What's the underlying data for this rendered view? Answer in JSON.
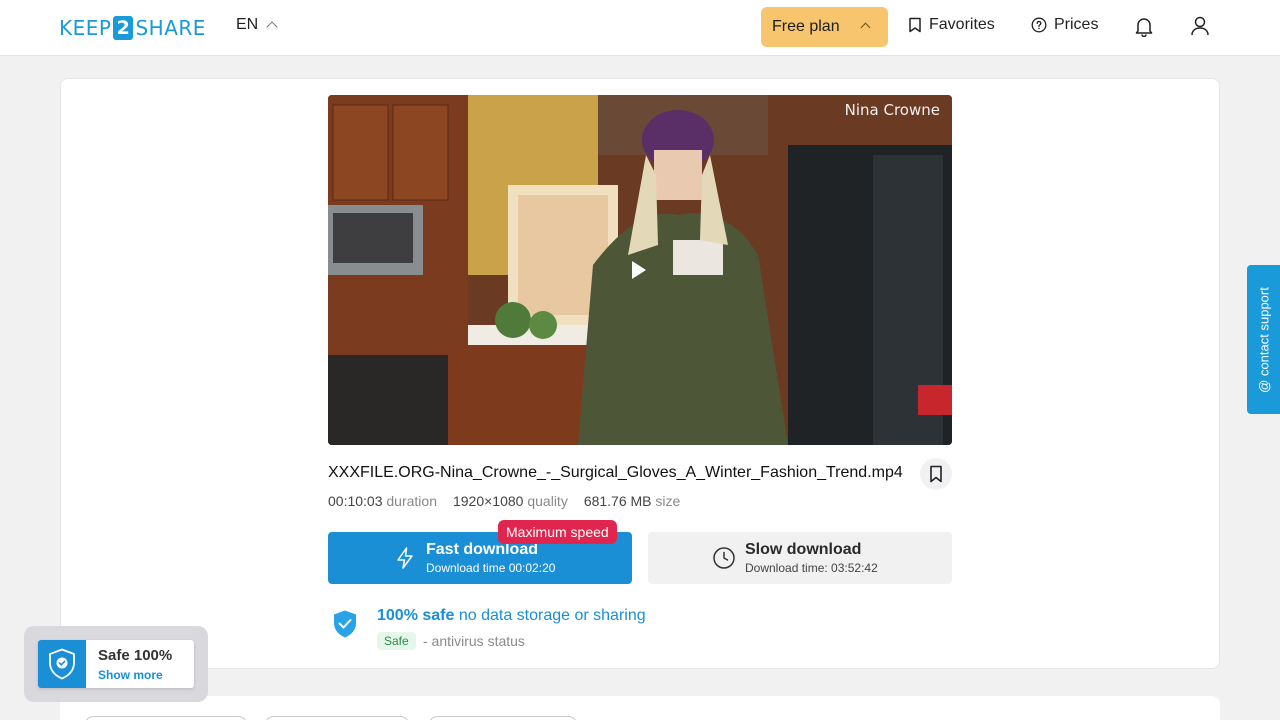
{
  "header": {
    "logo_left": "KEEP",
    "logo_mid": "2",
    "logo_right": "SHARE",
    "language": "EN",
    "plan_label": "Free plan",
    "favorites_label": "Favorites",
    "prices_label": "Prices"
  },
  "video": {
    "watermark": "Nina Crowne"
  },
  "file": {
    "name": "XXXFILE.ORG-Nina_Crowne_-_Surgical_Gloves_A_Winter_Fashion_Trend.mp4",
    "duration_value": "00:10:03",
    "duration_label": "duration",
    "quality_value": "1920×1080",
    "quality_label": "quality",
    "size_value": "681.76 MB",
    "size_label": "size"
  },
  "download": {
    "max_speed_badge": "Maximum speed",
    "fast_title": "Fast download",
    "fast_time": "Download time 00:02:20",
    "slow_title": "Slow download",
    "slow_time": "Download time: 03:52:42"
  },
  "safety": {
    "strong": "100% safe",
    "rest": "no data storage or sharing",
    "pill": "Safe",
    "status": "- antivirus status"
  },
  "support": {
    "label": "@ contact support"
  },
  "safe_widget": {
    "title": "Safe 100%",
    "link": "Show more"
  },
  "colors": {
    "brand": "#1a9ad8",
    "fast_button": "#1a8fd6",
    "plan_button": "#f6c56e",
    "badge": "#e0264f"
  }
}
